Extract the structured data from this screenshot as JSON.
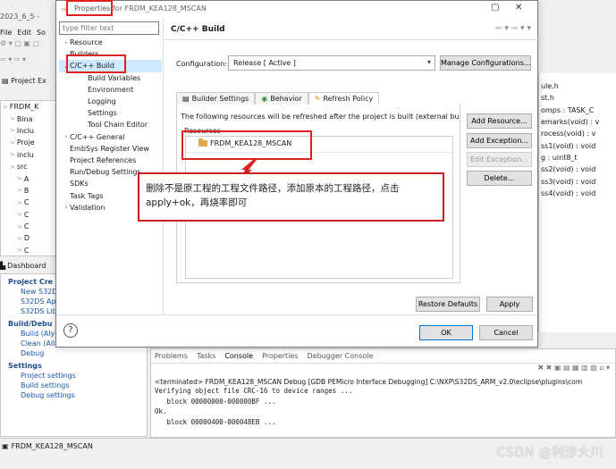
{
  "ide": {
    "window_title": "2023_6_5 -",
    "menu": [
      "File",
      "Edit",
      "So"
    ],
    "left_tree": [
      "FRDM_K",
      "Bina",
      "Inclu",
      "Proje",
      "inclu",
      "src",
      "A",
      "B",
      "C",
      "C",
      "C",
      "D",
      "C"
    ],
    "dashboard_label": "Dashboard",
    "sections": [
      {
        "title": "Project Cre",
        "items": [
          "New S32D",
          "S32DS Ap",
          "S32DS Lib"
        ]
      },
      {
        "title": "Build/Debu",
        "items": [
          "Build  (Aly",
          "Clean  (All)",
          "Debug"
        ]
      },
      {
        "title": "Settings",
        "items": [
          "Project settings",
          "Build settings",
          "Debug settings"
        ]
      }
    ],
    "right_outline": [
      "ule.h",
      "st.h",
      "omps : TASK_C",
      "emarks(void) : v",
      "rocess(void) : v",
      "ss1(void) : void",
      "g : uint8_t",
      "ss2(void) : void",
      "ss3(void) : void",
      "ss4(void) : void"
    ],
    "console": {
      "tabs": [
        "Problems",
        "Tasks",
        "Console",
        "Properties",
        "Debugger Console"
      ],
      "active_tab": "Console",
      "terminated": "<terminated> FRDM_KEA128_MSCAN Debug [GDB PEMicro Interface Debugging] C:\\NXP\\S32DS_ARM_v2.0\\eclipse\\plugins\\com",
      "lines": [
        "Verifying object file CRC-16 to device ranges ...",
        "   block 00000000-000000BF ...",
        "Ok.",
        "   block 00000400-000048EB ..."
      ]
    },
    "status_project": "FRDM_KEA128_MSCAN",
    "watermark": "CSDN @利涉大川"
  },
  "dialog": {
    "title_prefix": "Properties",
    "title_suffix": "for FRDM_KEA128_MSCAN",
    "filter_placeholder": "type filter text",
    "nav": [
      {
        "label": "Resource",
        "level": 0,
        "chevron": ">"
      },
      {
        "label": "Builders",
        "level": 0,
        "chevron": ""
      },
      {
        "label": "C/C++ Build",
        "level": 0,
        "chevron": "v",
        "selected": true
      },
      {
        "label": "Build Variables",
        "level": 1,
        "chevron": ""
      },
      {
        "label": "Environment",
        "level": 1,
        "chevron": ""
      },
      {
        "label": "Logging",
        "level": 1,
        "chevron": ""
      },
      {
        "label": "Settings",
        "level": 1,
        "chevron": ""
      },
      {
        "label": "Tool Chain Editor",
        "level": 1,
        "chevron": ""
      },
      {
        "label": "C/C++ General",
        "level": 0,
        "chevron": ">"
      },
      {
        "label": "EmbSys Register View",
        "level": 0,
        "chevron": ""
      },
      {
        "label": "Project References",
        "level": 0,
        "chevron": ""
      },
      {
        "label": "Run/Debug Settings",
        "level": 0,
        "chevron": ""
      },
      {
        "label": "SDKs",
        "level": 0,
        "chevron": ""
      },
      {
        "label": "Task Tags",
        "level": 0,
        "chevron": ""
      },
      {
        "label": "Validation",
        "level": 0,
        "chevron": ">"
      }
    ],
    "page_title": "C/C++ Build",
    "configuration_label": "Configuration:",
    "configuration_value": "Release  [ Active ]",
    "manage_button": "Manage Configurations...",
    "tabs": [
      "Builder Settings",
      "Behavior",
      "Refresh Policy"
    ],
    "active_tab": "Refresh Policy",
    "description": "The following resources will be refreshed after the project is built (external builde",
    "resources_label": "Resources",
    "resource_item": "FRDM_KEA128_MSCAN",
    "side_buttons": [
      {
        "label": "Add Resource...",
        "enabled": true
      },
      {
        "label": "Add Exception...",
        "enabled": true
      },
      {
        "label": "Edit Exception...",
        "enabled": false
      },
      {
        "label": "Delete...",
        "enabled": true
      }
    ],
    "annotation": "删除不是原工程的工程文件路径，添加原本的工程路径，点击apply+ok，再烧率即可",
    "restore_defaults": "Restore Defaults",
    "apply": "Apply",
    "ok": "OK",
    "cancel": "Cancel"
  },
  "colors": {
    "highlight": "#e02020",
    "selection": "#cde8ff",
    "link": "#1558a8"
  }
}
